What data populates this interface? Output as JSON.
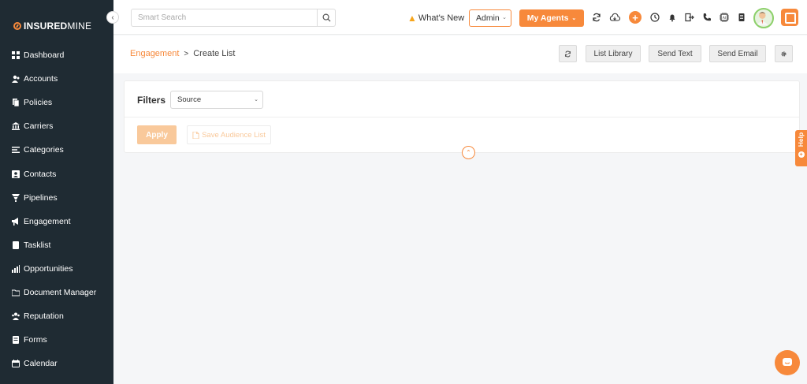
{
  "brand": {
    "name_bold": "INSURED",
    "name_light": "MINE"
  },
  "sidebar": {
    "items": [
      {
        "label": "Dashboard",
        "icon": "dashboard-icon"
      },
      {
        "label": "Accounts",
        "icon": "accounts-icon"
      },
      {
        "label": "Policies",
        "icon": "policies-icon"
      },
      {
        "label": "Carriers",
        "icon": "carriers-icon"
      },
      {
        "label": "Categories",
        "icon": "categories-icon"
      },
      {
        "label": "Contacts",
        "icon": "contacts-icon"
      },
      {
        "label": "Pipelines",
        "icon": "pipelines-icon"
      },
      {
        "label": "Engagement",
        "icon": "engagement-icon"
      },
      {
        "label": "Tasklist",
        "icon": "tasklist-icon"
      },
      {
        "label": "Opportunities",
        "icon": "opportunities-icon"
      },
      {
        "label": "Document Manager",
        "icon": "folder-icon"
      },
      {
        "label": "Reputation",
        "icon": "reputation-icon"
      },
      {
        "label": "Forms",
        "icon": "forms-icon"
      },
      {
        "label": "Calendar",
        "icon": "calendar-icon"
      }
    ]
  },
  "topbar": {
    "search_placeholder": "Smart Search",
    "whats_new": "What's New",
    "admin_select": "Admin",
    "agents_button": "My Agents",
    "icons": [
      "refresh-icon",
      "cloud-icon",
      "plus-icon",
      "clock-icon",
      "bell-icon",
      "logout-icon",
      "phone-icon",
      "ai-chip-icon",
      "document-icon",
      "user-avatar",
      "brand-app-icon"
    ]
  },
  "header": {
    "breadcrumb_link": "Engagement",
    "breadcrumb_sep": ">",
    "breadcrumb_current": "Create List",
    "list_library": "List Library",
    "send_text": "Send Text",
    "send_email": "Send Email"
  },
  "filters": {
    "label": "Filters",
    "source_select": "Source",
    "apply": "Apply",
    "save_audience": "Save Audience List"
  },
  "help": {
    "label": "Help"
  },
  "colors": {
    "accent": "#f7893b",
    "sidebar_bg": "#1f2b33",
    "accent_light": "#f9c99b"
  }
}
